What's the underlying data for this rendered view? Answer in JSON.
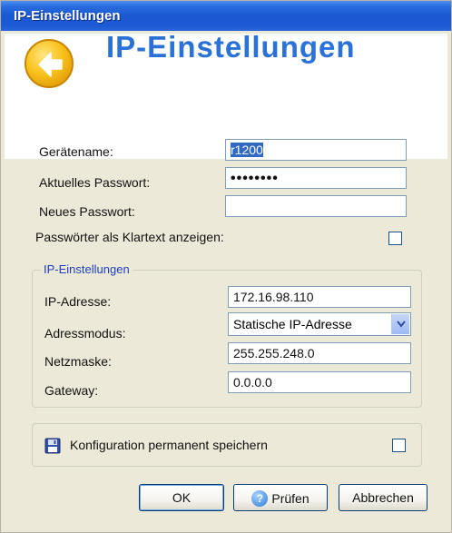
{
  "window": {
    "title": "IP-Einstellungen"
  },
  "banner": {
    "title": "IP-Einstellungen",
    "icon": "back-arrow-icon"
  },
  "form": {
    "device_name_label": "Gerätename:",
    "device_name_value": "r1200",
    "current_password_label": "Aktuelles Passwort:",
    "current_password_value": "••••••••",
    "new_password_label": "Neues Passwort:",
    "new_password_value": "",
    "show_plaintext_label": "Passwörter als Klartext anzeigen:",
    "show_plaintext_checked": false
  },
  "ip_group": {
    "legend": "IP-Einstellungen",
    "ip_label": "IP-Adresse:",
    "ip_value": "172.16.98.110",
    "mode_label": "Adressmodus:",
    "mode_value": "Statische IP-Adresse",
    "netmask_label": "Netzmaske:",
    "netmask_value": "255.255.248.0",
    "gateway_label": "Gateway:",
    "gateway_value": "0.0.0.0"
  },
  "save": {
    "label": "Konfiguration permanent speichern",
    "checked": false,
    "icon": "floppy-disk-icon"
  },
  "buttons": {
    "ok": "OK",
    "check": "Prüfen",
    "cancel": "Abbrechen"
  },
  "colors": {
    "titlebar": "#1a57d0",
    "banner_title": "#2a72d8",
    "group_legend": "#1d3fbf",
    "window_bg": "#ece9d8"
  }
}
